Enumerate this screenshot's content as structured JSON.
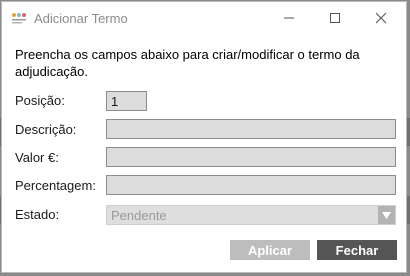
{
  "window": {
    "title": "Adicionar Termo",
    "icon": "app-logo-icon",
    "controls": [
      "minimize-icon",
      "maximize-icon",
      "close-icon"
    ]
  },
  "instructions": "Preencha os campos abaixo para criar/modificar o termo da adjudicação.",
  "form": {
    "posicao": {
      "label": "Posição:",
      "value": "1"
    },
    "descricao": {
      "label": "Descrição:",
      "value": ""
    },
    "valor": {
      "label": "Valor €:",
      "value": ""
    },
    "percentagem": {
      "label": "Percentagem:",
      "value": ""
    },
    "estado": {
      "label": "Estado:",
      "value": "Pendente"
    }
  },
  "buttons": {
    "apply": "Aplicar",
    "close": "Fechar"
  },
  "colors": {
    "field_bg": "#dcdcdc",
    "apply_bg": "#bdbdbd",
    "close_bg": "#555555",
    "title_text": "#8c8c8c"
  }
}
